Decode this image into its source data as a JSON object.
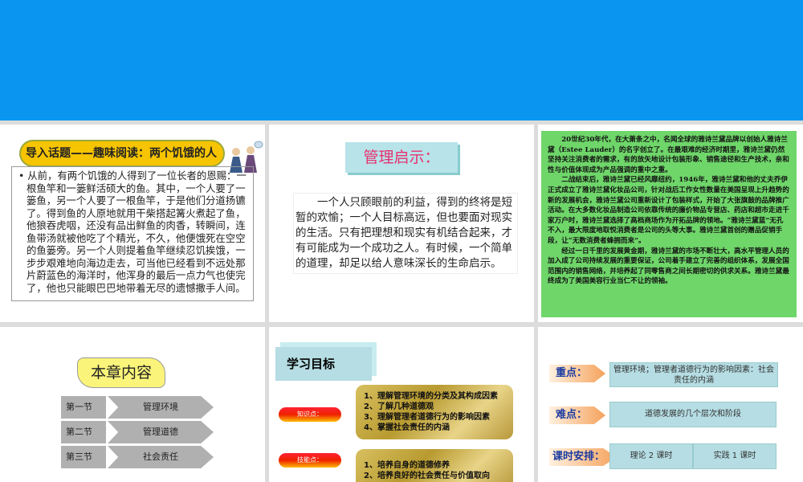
{
  "slide1": {
    "topic": "导入话题——趣味阅读：两个饥饿的人",
    "story": "• 从前，有两个饥饿的人得到了一位长者的恩赐：一根鱼竿和一篓鲜活硕大的鱼。其中，一个人要了一篓鱼，另一个人要了一根鱼竿，于是他们分道扬镳了。得到鱼的人原地就用干柴搭起篝火煮起了鱼，他狼吞虎咽，还没有品出鲜鱼的肉香，转瞬间，连鱼带汤就被他吃了个精光，不久，他便饿死在空空的鱼篓旁。另一个人则提着鱼竿继续忍饥挨饿，一步步艰难地向海边走去，可当他已经看到不远处那片蔚蓝色的海洋时，他浑身的最后一点力气也使完了，他也只能眼巴巴地带着无尽的遗憾撒手人间。"
  },
  "slide2": {
    "title": "管理启示：",
    "body": "一个人只顾眼前的利益，得到的终将是短暂的欢愉；一个人目标高远，但也要面对现实的生活。只有把理想和现实有机结合起来，才有可能成为一个成功之人。有时候，一个简单的道理，却足以给人意味深长的生命启示。"
  },
  "slide3": {
    "paragraphs": [
      "20世纪30年代，在大萧条之中，名闻全球的雅诗兰黛品牌以创始人雅诗兰黛（Estee Lauder）的名字创立了。在最艰难的经济时期里，雅诗兰黛仍然坚持关注消费者的需求，有的放矢地设计包装形象、销售途径和生产技术，亲和性与价值体现成为产品强调的重中之重。",
      "二战结束后，雅诗兰黛已经风靡纽约，1946年，雅诗兰黛和他的丈夫乔伊正式成立了雅诗兰黛化妆品公司，针对战后工作女性数量在美国呈现上升趋势的新的发展机会，雅诗兰黛公司重新设计了包装样式，开始了大张旗鼓的品牌推广活动。在大多数化妆品制造公司依靠传统的廉价物品专营店、药店和超市走进千家万户时，雅诗兰黛选择了高档商场作为开拓品牌的领地。“雅诗兰黛蓝”无孔不入，最大限度地取悦消费者是公司的头等大事。雅诗兰黛首创的赠品促销手段，让“无数消费者蜂拥而来”。",
      "经过一日千里的发展黄金期，雅诗兰黛的市场不断壮大，高水平管理人员的加入成了公司持续发展的重要保证，公司着手建立了完善的组织体系，发展全国范围内的销售网络，并培养起了同零售商之间长期密切的供求关系。雅诗兰黛最终成为了美国美容行业当仁不让的领袖。"
    ]
  },
  "slide4": {
    "title": "本章内容",
    "sections": [
      {
        "num": "第一节",
        "name": "管理环境"
      },
      {
        "num": "第二节",
        "name": "管理道德"
      },
      {
        "num": "第三节",
        "name": "社会责任"
      }
    ]
  },
  "slide5": {
    "title": "学习目标",
    "knowledge_label": "知识点：",
    "knowledge": [
      "1、理解管理环境的分类及其构成因素",
      "2、了解几种道德观",
      "3、理解管理者道德行为的影响因素",
      "4、掌握社会责任的内涵"
    ],
    "skill_label": "技能点：",
    "skills": [
      "1、培养自身的道德修养",
      "2、培养良好的社会责任与价值取向"
    ]
  },
  "slide6": {
    "key_label": "重点：",
    "key": "管理环境；管理者道德行为的影响因素：社会责任的内涵",
    "hard_label": "难点：",
    "hard": "道德发展的几个层次和阶段",
    "hours_label": "课时安排：",
    "theory": "理论 2 课时",
    "practice": "实践 1 课时"
  }
}
